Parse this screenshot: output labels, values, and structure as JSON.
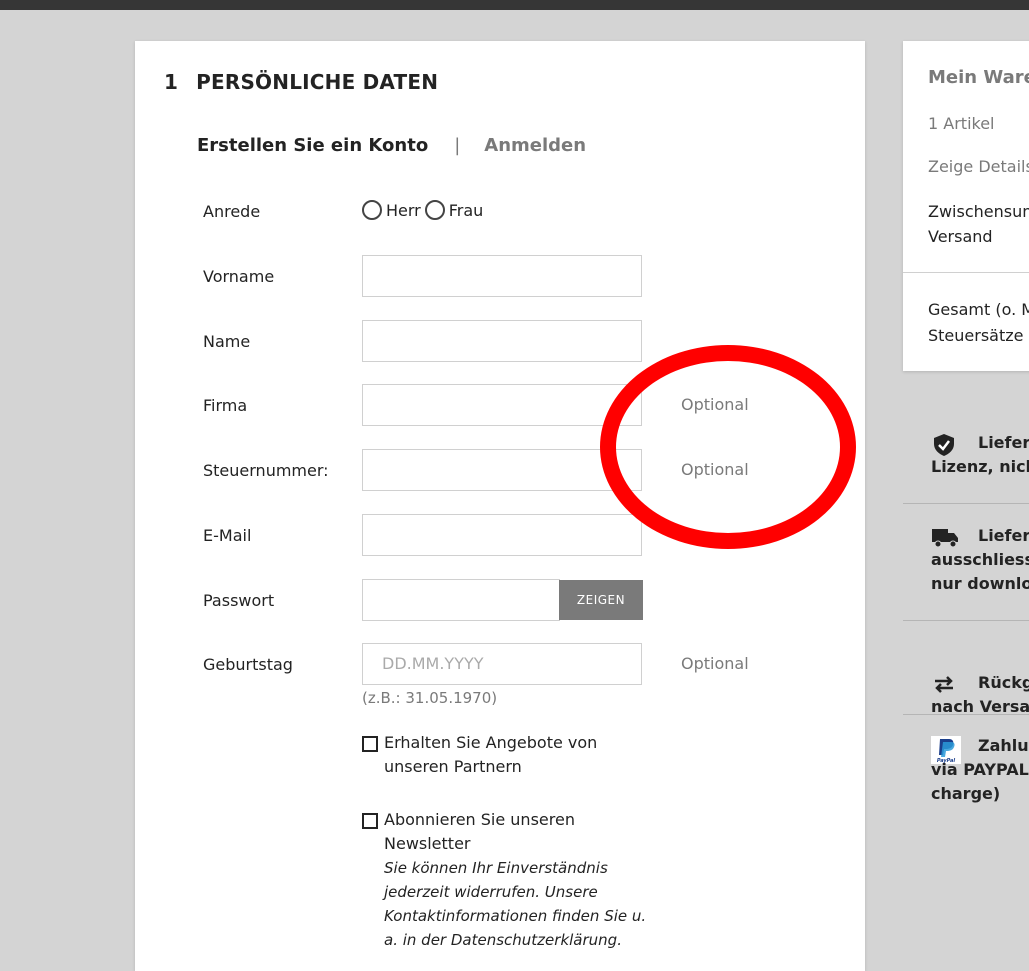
{
  "section": {
    "number": "1",
    "title": "PERSÖNLICHE DATEN"
  },
  "tabs": {
    "create_account": "Erstellen Sie ein Konto",
    "separator": "|",
    "login": "Anmelden"
  },
  "form": {
    "salutation": {
      "label": "Anrede",
      "options": [
        "Herr",
        "Frau"
      ]
    },
    "first_name": {
      "label": "Vorname",
      "value": ""
    },
    "last_name": {
      "label": "Name",
      "value": ""
    },
    "company": {
      "label": "Firma",
      "value": "",
      "optional": "Optional"
    },
    "tax_number": {
      "label": "Steuernummer:",
      "value": "",
      "optional": "Optional"
    },
    "email": {
      "label": "E-Mail",
      "value": ""
    },
    "password": {
      "label": "Passwort",
      "value": "",
      "show_button": "ZEIGEN"
    },
    "birthday": {
      "label": "Geburtstag",
      "placeholder": "DD.MM.YYYY",
      "hint": "(z.B.: 31.05.1970)",
      "optional": "Optional"
    },
    "partner_offers": {
      "label_line1": "Erhalten Sie Angebote von",
      "label_line2": "unseren Partnern",
      "checked": false
    },
    "newsletter": {
      "label_line1": "Abonnieren Sie unseren",
      "label_line2": "Newsletter",
      "note_lines": [
        "Sie können Ihr Einverständnis",
        "jederzeit widerrufen. Unsere",
        "Kontaktinformationen finden Sie u.",
        "a. in der Datenschutzerklärung."
      ],
      "checked": false
    }
  },
  "cart": {
    "title": "Mein Ware",
    "items_count": "1 Artikel",
    "show_details": "Zeige Details",
    "subtotal_label": "Zwischensum",
    "shipping_label": "Versand",
    "total_label": "Gesamt (o. M",
    "tax_label": "Steuersätze"
  },
  "info": [
    {
      "icon": "shield-check-icon",
      "title": "Liefer",
      "body": [
        "Lizenz, nich"
      ]
    },
    {
      "icon": "truck-icon",
      "title": "Liefer",
      "body": [
        "ausschliess",
        "nur downlo"
      ]
    },
    {
      "icon": "exchange-arrows-icon",
      "title": "Rückg",
      "body": [
        "nach Versa"
      ]
    },
    {
      "icon": "paypal-icon",
      "title": "Zahlu",
      "body": [
        "via PAYPAL",
        "charge)"
      ]
    }
  ],
  "colors": {
    "annotation": "#ff0000",
    "muted": "#7a7a7a",
    "button_bg": "#7a7a7a",
    "background": "#d4d4d4"
  }
}
